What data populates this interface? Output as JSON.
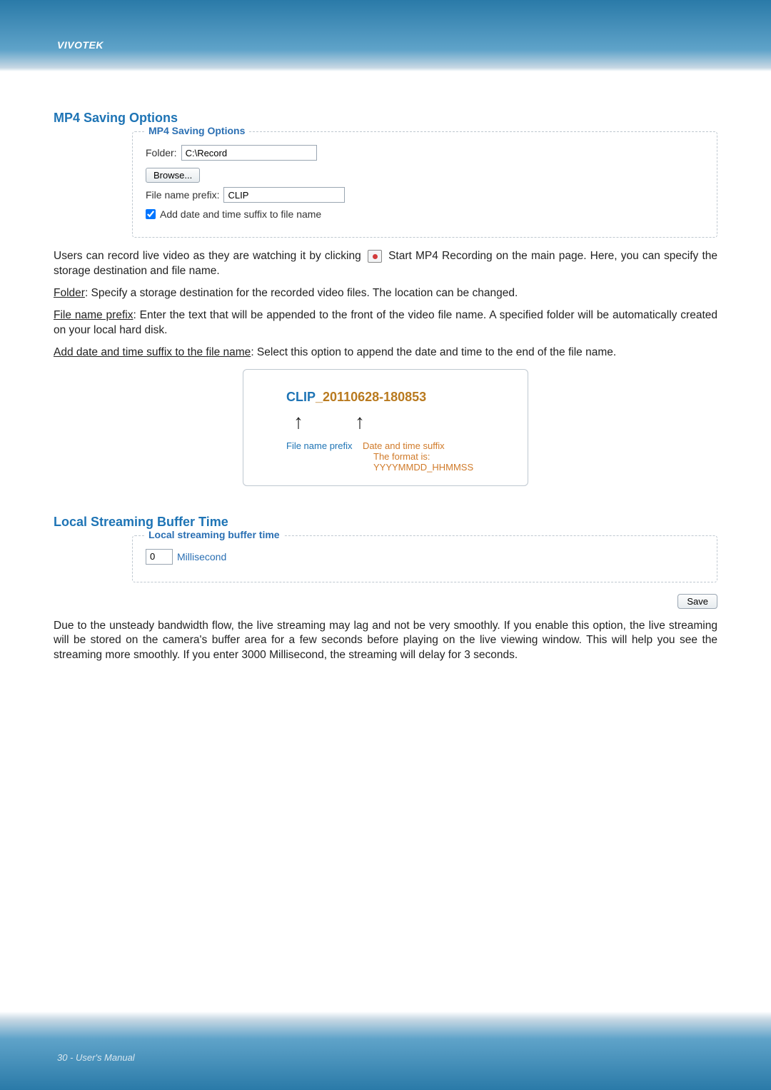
{
  "brand": "VIVOTEK",
  "footer": "30 - User's Manual",
  "sections": {
    "mp4": {
      "title": "MP4 Saving Options",
      "legend": "MP4 Saving Options",
      "folder_label": "Folder:",
      "folder_value": "C:\\Record",
      "browse_label": "Browse...",
      "prefix_label": "File name prefix:",
      "prefix_value": "CLIP",
      "checkbox_label": "Add date and time suffix to file name"
    },
    "buffer": {
      "title": "Local Streaming Buffer Time",
      "legend": "Local streaming buffer time",
      "value": "0",
      "unit": "Millisecond",
      "save_label": "Save"
    }
  },
  "paragraphs": {
    "p1a": "Users can record live video as they are watching it by clicking",
    "p1b": "Start MP4 Recording on the main page. Here, you can specify the storage destination and file name.",
    "p2_u": "Folder",
    "p2": ": Specify a storage destination for the recorded video files. The location can be changed.",
    "p3_u": "File name prefix",
    "p3": ": Enter the text that will be appended to the front of the video file name. A specified folder will be automatically created on your local hard disk.",
    "p4_u": "Add date and time suffix to the file name",
    "p4": ": Select this option to append the date and time to the end of the file name.",
    "p5": "Due to the unsteady bandwidth flow, the live streaming may lag and not be very smoothly. If you enable this option, the live streaming will be stored on the camera's buffer area for a few seconds before playing on the live viewing window. This will help you see the streaming more smoothly. If you enter 3000 Millisecond, the streaming will delay for 3 seconds."
  },
  "diagram": {
    "prefix": "CLIP",
    "underscore": "_",
    "suffix": "20110628-180853",
    "label_prefix": "File name prefix",
    "label_suffix": "Date and time suffix",
    "label_format": "The format is: YYYYMMDD_HHMMSS"
  }
}
